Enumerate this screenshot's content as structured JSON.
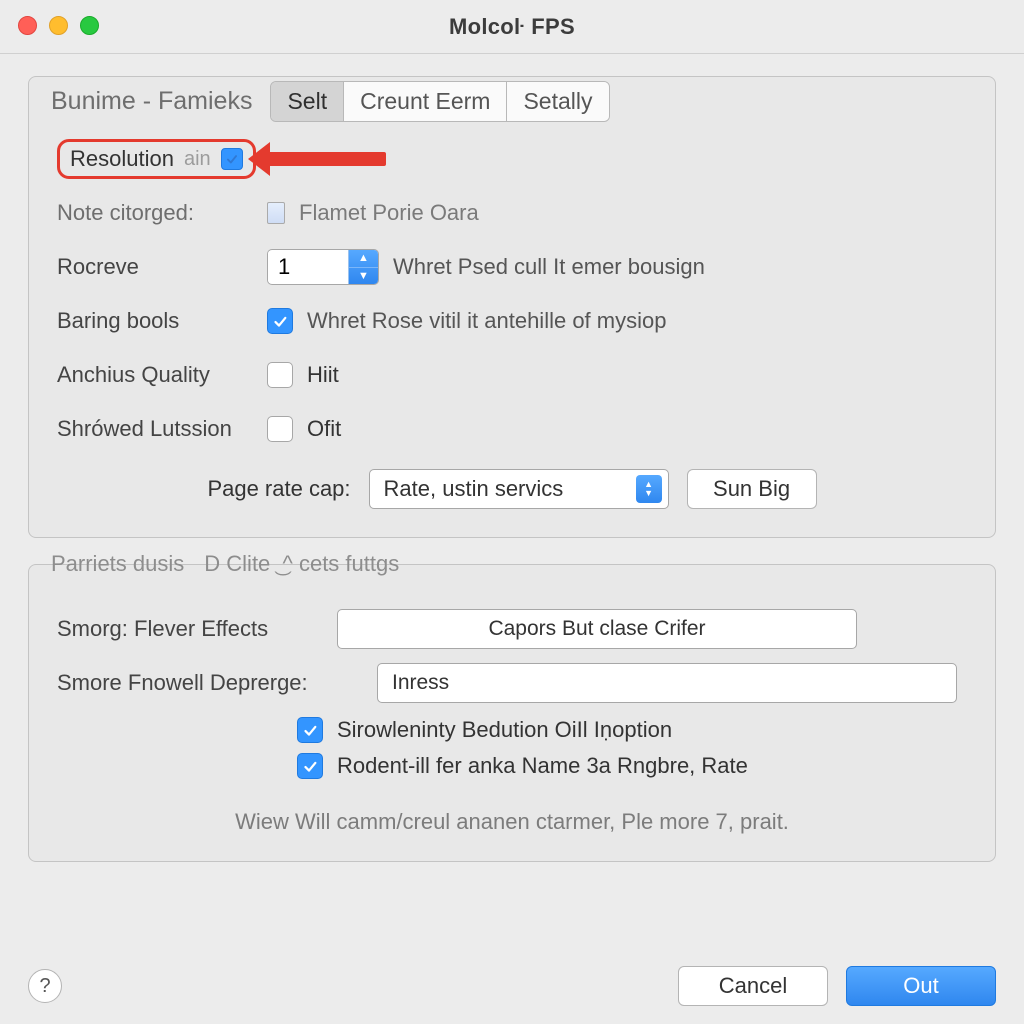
{
  "window": {
    "title": "Molcoŀ FPS"
  },
  "group1": {
    "title": "Bunime - Famieks",
    "tabs": [
      "Selt",
      "Creunt Eerm",
      "Setally"
    ],
    "activeTab": 0
  },
  "resolution": {
    "label": "Resolution",
    "sublabel": "ain",
    "checked": true
  },
  "note": {
    "label": "Note citorged:",
    "text": "Flamet Porie Oara"
  },
  "rocreve": {
    "label": "Rocreve",
    "value": "1",
    "text": "Whret Psed cull It emer bousign"
  },
  "baring": {
    "label": "Baring bools",
    "checked": true,
    "text": "Whret Rose vitil it antehille of mysiop"
  },
  "anchius": {
    "label": "Anchius Quality",
    "checked": false,
    "text": "Hiit"
  },
  "shrowed": {
    "label": "Shrówed Lutssion",
    "checked": false,
    "text": "Ofit"
  },
  "pagecap": {
    "label": "Page rate cap:",
    "selectValue": "Rate, ustin servics",
    "button": "Sun Big"
  },
  "group2": {
    "title": "Parriets dusis",
    "legend": "D Clite  ͜ ^  cets futtgs"
  },
  "smorg": {
    "label": "Smorg: Flever Effects",
    "value": "Capors But clase Crifer"
  },
  "smore": {
    "label": "Smore Fnowell Deprerge:",
    "value": "Inress"
  },
  "extra1": {
    "checked": true,
    "text": "Sirowleninty Bedution OiIl Iṇoption"
  },
  "extra2": {
    "checked": true,
    "text": "Rodent-ill fer anka Name 3a Rngbre, Rate"
  },
  "hint": "Wiew Will camm/creul ananen ctarmer, Ple more 7, prait.",
  "footer": {
    "help": "?",
    "cancel": "Cancel",
    "ok": "Out"
  }
}
